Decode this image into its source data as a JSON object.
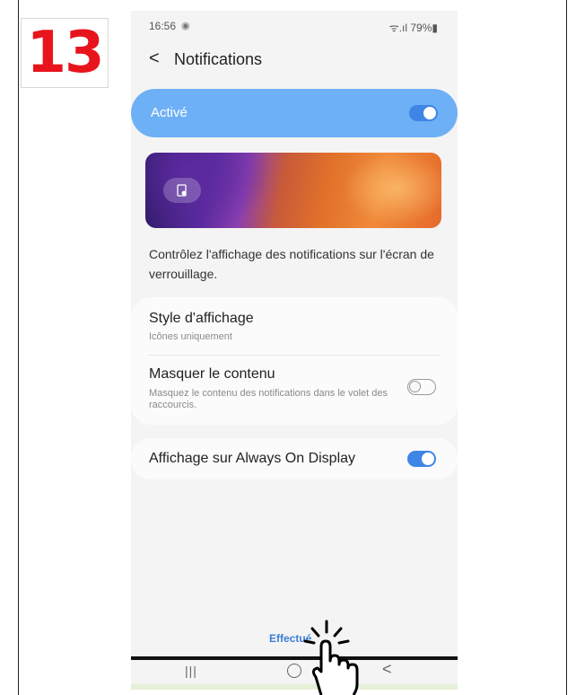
{
  "step_number": "13",
  "status_bar": {
    "time": "16:56",
    "indicator": "◉",
    "right": "ᯤ.ıl 79%▮"
  },
  "header": {
    "back_symbol": "<",
    "title": "Notifications"
  },
  "master_toggle": {
    "label": "Activé",
    "state": "on"
  },
  "preview": {
    "icon": "lock-screen-settings-icon"
  },
  "description": "Contrôlez l'affichage des notifications sur l'écran de verrouillage.",
  "settings": {
    "style": {
      "title": "Style d'affichage",
      "subtitle": "Icônes uniquement"
    },
    "hide_content": {
      "title": "Masquer le contenu",
      "subtitle": "Masquez le contenu des notifications dans le volet des raccourcis.",
      "state": "off"
    },
    "aod": {
      "title": "Affichage sur Always On Display",
      "state": "on"
    }
  },
  "bottom": {
    "button_text": "Effectué"
  },
  "nav": {
    "recents": "|||",
    "back": "<"
  },
  "colors": {
    "accent": "#3f85e6",
    "master_bg": "#6eb0f5",
    "step_badge": "#e8141c"
  }
}
